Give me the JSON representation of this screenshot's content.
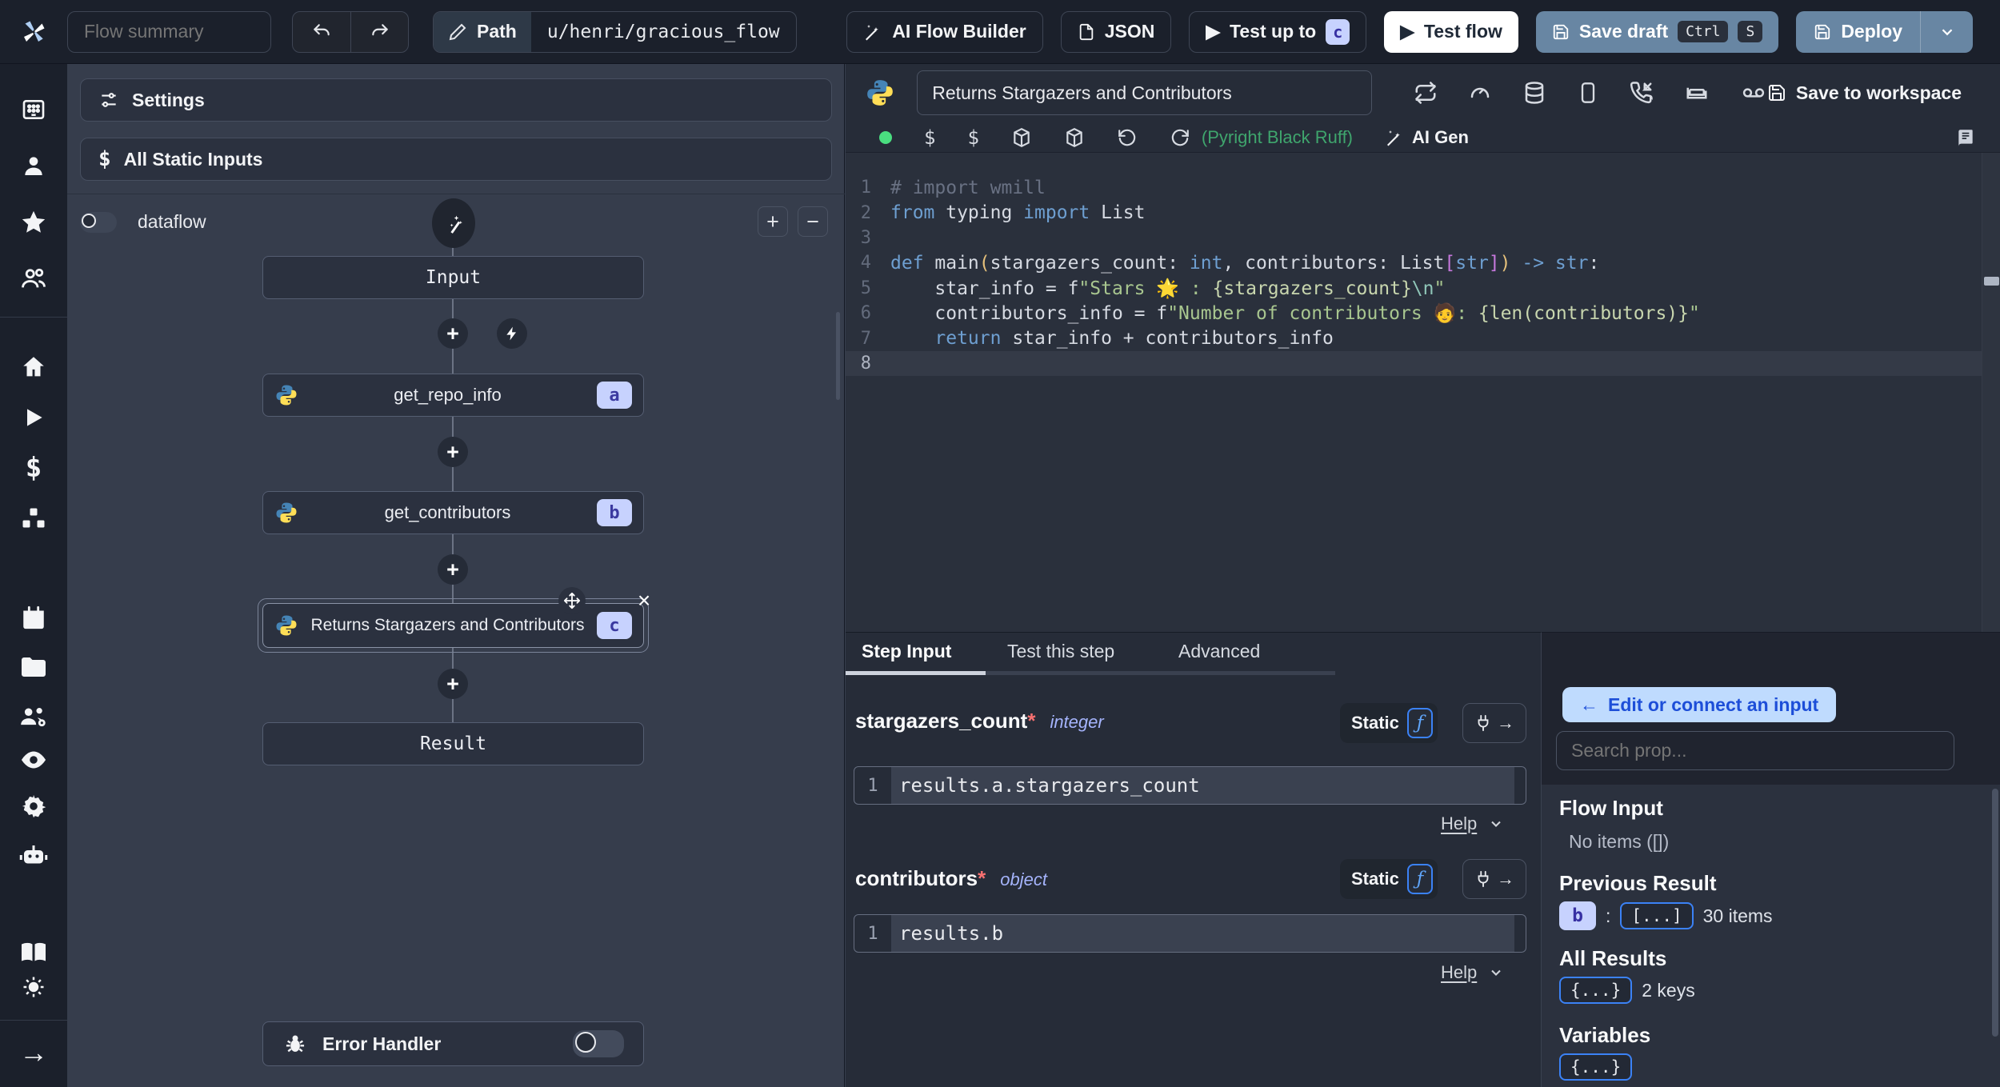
{
  "header": {
    "flow_summary_placeholder": "Flow summary",
    "path_label": "Path",
    "path_value": "u/henri/gracious_flow",
    "ai_flow_builder": "AI Flow Builder",
    "json": "JSON",
    "test_up_to": "Test up to",
    "test_up_to_badge": "c",
    "test_flow": "Test flow",
    "save_draft": "Save draft",
    "kbd_ctrl": "Ctrl",
    "kbd_s": "S",
    "deploy": "Deploy"
  },
  "flow_panel": {
    "settings": "Settings",
    "all_static_inputs": "All Static Inputs",
    "dataflow_label": "dataflow",
    "plus": "+",
    "minus": "−",
    "input_node": "Input",
    "result_node": "Result",
    "error_handler": "Error Handler",
    "steps": [
      {
        "name": "get_repo_info",
        "badge": "a"
      },
      {
        "name": "get_contributors",
        "badge": "b"
      },
      {
        "name": "Returns Stargazers and Contributors",
        "badge": "c"
      }
    ],
    "close_glyph": "×"
  },
  "editor": {
    "title": "Returns Stargazers and Contributors",
    "save_to_workspace": "Save to workspace",
    "lint": "(Pyright Black Ruff)",
    "ai_gen": "AI Gen",
    "lines": [
      {
        "tokens": [
          {
            "t": "# import wmill",
            "c": "comment"
          }
        ]
      },
      {
        "tokens": [
          {
            "t": "from",
            "c": "kw"
          },
          {
            "t": " typing ",
            "c": "plain"
          },
          {
            "t": "import",
            "c": "kw"
          },
          {
            "t": " List",
            "c": "plain"
          }
        ]
      },
      {
        "tokens": []
      },
      {
        "tokens": [
          {
            "t": "def ",
            "c": "kw"
          },
          {
            "t": "main",
            "c": "plain"
          },
          {
            "t": "(",
            "c": "paren"
          },
          {
            "t": "stargazers_count: ",
            "c": "plain"
          },
          {
            "t": "int",
            "c": "type"
          },
          {
            "t": ", contributors: List",
            "c": "plain"
          },
          {
            "t": "[",
            "c": "bracket"
          },
          {
            "t": "str",
            "c": "type"
          },
          {
            "t": "]",
            "c": "bracket"
          },
          {
            "t": ")",
            "c": "paren"
          },
          {
            "t": " -> ",
            "c": "kw"
          },
          {
            "t": "str",
            "c": "type"
          },
          {
            "t": ":",
            "c": "plain"
          }
        ]
      },
      {
        "tokens": [
          {
            "t": "    star_info = ",
            "c": "plain"
          },
          {
            "t": "f",
            "c": "plain"
          },
          {
            "t": "\"Stars ",
            "c": "str"
          },
          {
            "t": "🌟",
            "c": "emoji"
          },
          {
            "t": " : ",
            "c": "str"
          },
          {
            "t": "{stargazers_count}",
            "c": "interp"
          },
          {
            "t": "\\n",
            "c": "esc"
          },
          {
            "t": "\"",
            "c": "str"
          }
        ]
      },
      {
        "tokens": [
          {
            "t": "    contributors_info = ",
            "c": "plain"
          },
          {
            "t": "f",
            "c": "plain"
          },
          {
            "t": "\"Number of contributors ",
            "c": "str"
          },
          {
            "t": "🧑",
            "c": "emoji"
          },
          {
            "t": ": ",
            "c": "str"
          },
          {
            "t": "{len(contributors)}",
            "c": "interp"
          },
          {
            "t": "\"",
            "c": "str"
          }
        ]
      },
      {
        "tokens": [
          {
            "t": "    ",
            "c": "plain"
          },
          {
            "t": "return",
            "c": "kw"
          },
          {
            "t": " star_info + contributors_info",
            "c": "plain"
          }
        ]
      },
      {
        "tokens": []
      }
    ],
    "current_line": 8
  },
  "step_panel": {
    "tabs": [
      "Step Input",
      "Test this step",
      "Advanced"
    ],
    "fields": [
      {
        "name": "stargazers_count",
        "required": "*",
        "type": "integer",
        "static_label": "Static",
        "fx": "ƒ",
        "line_no": "1",
        "expr": "results.a.stargazers_count",
        "help": "Help"
      },
      {
        "name": "contributors",
        "required": "*",
        "type": "object",
        "static_label": "Static",
        "fx": "ƒ",
        "line_no": "1",
        "expr": "results.b",
        "help": "Help"
      }
    ]
  },
  "connect_panel": {
    "edit_arrow": "←",
    "edit_button": "Edit or connect an input",
    "search_placeholder": "Search prop...",
    "flow_input_title": "Flow Input",
    "flow_input_empty": "No items ([])",
    "previous_result_title": "Previous Result",
    "previous_result_key": "b",
    "previous_result_sep": ":",
    "previous_result_badge": "[...]",
    "previous_result_count": "30 items",
    "all_results_title": "All Results",
    "all_results_badge": "{...}",
    "all_results_count": "2 keys",
    "variables_title": "Variables",
    "variables_badge": "{...}"
  },
  "colors": {
    "header_bg": "#1b202b",
    "panel_bg": "#363d4c",
    "node_bg": "#2b313f",
    "editor_bg": "#2a303c",
    "accent_blue": "#3b82f6",
    "badge_bg": "#c7d2fe",
    "badge_text": "#3730a3",
    "steel_button": "#6886a3",
    "lint_green": "#3fa56d",
    "ready_dot": "#4ade80",
    "edit_button_bg": "#bfdbfe",
    "edit_button_text": "#1d4ed8"
  }
}
